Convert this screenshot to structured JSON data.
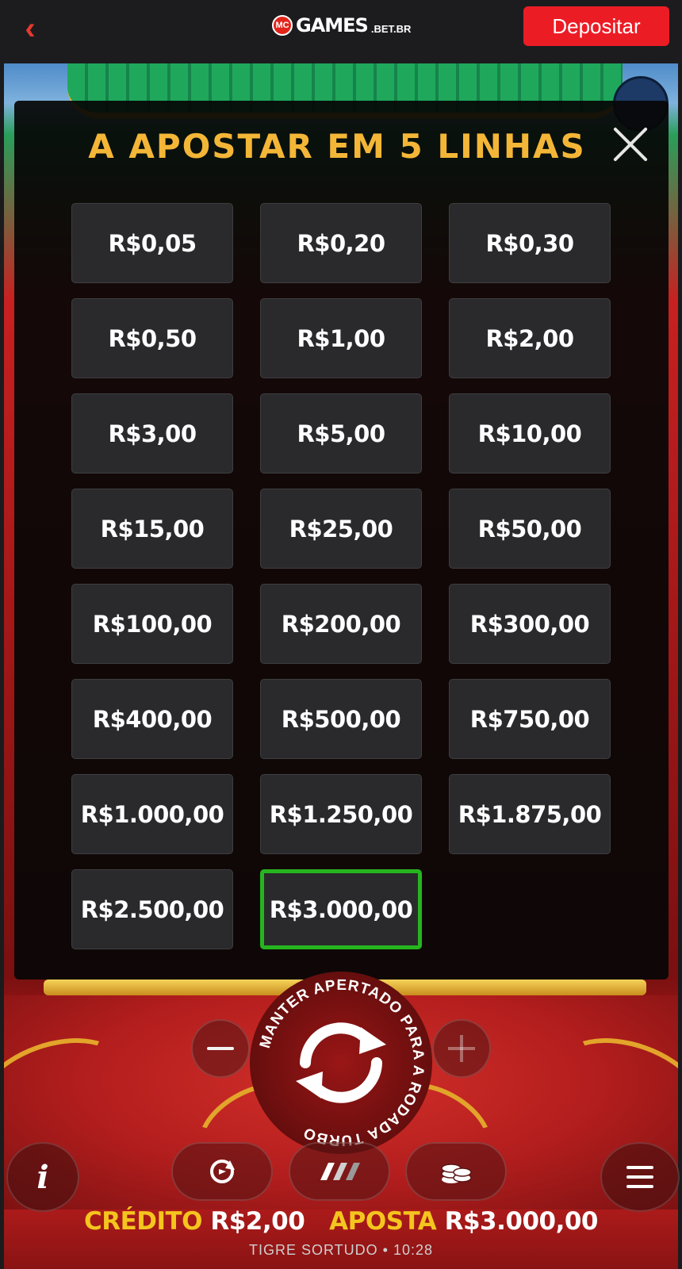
{
  "header": {
    "back_icon": "chevron-left-icon",
    "logo_badge": "MC",
    "logo_main": "GAMES",
    "logo_suffix": ".BET.BR",
    "deposit_label": "Depositar",
    "accent_color": "#ec1c25"
  },
  "bet_modal": {
    "title": "A APOSTAR EM 5 LINHAS",
    "close_icon": "close-icon",
    "selected_index": 22,
    "selected_color": "#26b51f",
    "options": [
      "R$0,05",
      "R$0,20",
      "R$0,30",
      "R$0,50",
      "R$1,00",
      "R$2,00",
      "R$3,00",
      "R$5,00",
      "R$10,00",
      "R$15,00",
      "R$25,00",
      "R$50,00",
      "R$100,00",
      "R$200,00",
      "R$300,00",
      "R$400,00",
      "R$500,00",
      "R$750,00",
      "R$1.000,00",
      "R$1.250,00",
      "R$1.875,00",
      "R$2.500,00",
      "R$3.000,00"
    ]
  },
  "controls": {
    "spin_hint": "MANTER APERTADO PARA A RODADA TURBO",
    "spin_icon": "refresh-arrows-icon",
    "minus_icon": "minus-icon",
    "plus_icon": "plus-icon",
    "autoplay_icon": "autoplay-icon",
    "turbo_icon": "turbo-icon",
    "coins_icon": "coins-stack-icon",
    "info_label": "i",
    "menu_icon": "hamburger-menu-icon"
  },
  "status": {
    "credit_label": "CRÉDITO",
    "credit_value": "R$2,00",
    "bet_label": "APOSTA",
    "bet_value": "R$3.000,00"
  },
  "footer": {
    "game_name": "TIGRE SORTUDO",
    "separator": "•",
    "time": "10:28"
  }
}
